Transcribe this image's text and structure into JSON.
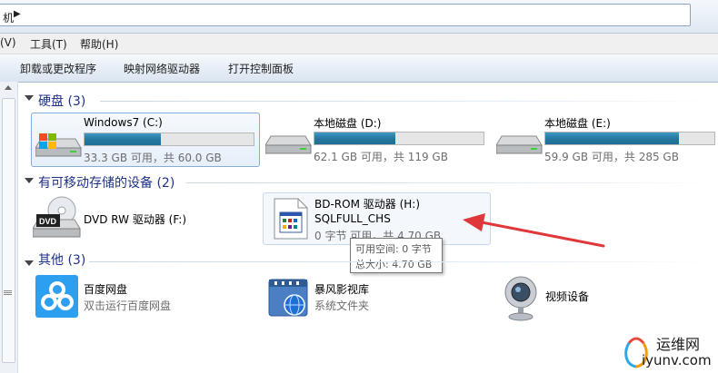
{
  "address": {
    "text": "机"
  },
  "menu": [
    "(V)",
    "工具(T)",
    "帮助(H)"
  ],
  "toolbar": [
    "卸载或更改程序",
    "映射网络驱动器",
    "打开控制面板"
  ],
  "groups": {
    "hard_disks": "硬盘 (3)",
    "removable": "有可移动存储的设备 (2)",
    "other": "其他 (3)"
  },
  "drives": [
    {
      "name": "Windows7 (C:)",
      "free": "33.3 GB 可用，共 60.0 GB",
      "used_fraction": 0.45
    },
    {
      "name": "本地磁盘 (D:)",
      "free": "62.1 GB 可用，共 119 GB",
      "used_fraction": 0.48
    },
    {
      "name": "本地磁盘 (E:)",
      "free": "59.9 GB 可用，共 285 GB",
      "used_fraction": 0.79
    }
  ],
  "removable": [
    {
      "name": "DVD RW 驱动器 (F:)"
    },
    {
      "name": "BD-ROM 驱动器 (H:)",
      "label": "SQLFULL_CHS",
      "free": "0 字节 可用，共 4.70 GB"
    }
  ],
  "tooltip": {
    "line1": "可用空间: 0 字节",
    "line2": "总大小: 4.70 GB"
  },
  "other": [
    {
      "name": "百度网盘",
      "sub": "双击运行百度网盘"
    },
    {
      "name": "暴风影视库",
      "sub": "系统文件夹"
    },
    {
      "name": "视频设备"
    }
  ],
  "watermark": {
    "cn": "运维网",
    "en": "iyunv.com"
  },
  "colors": {
    "accent_arrow": "#e0383a",
    "group_title": "#1e3287",
    "bar_fill": "#26789f"
  }
}
